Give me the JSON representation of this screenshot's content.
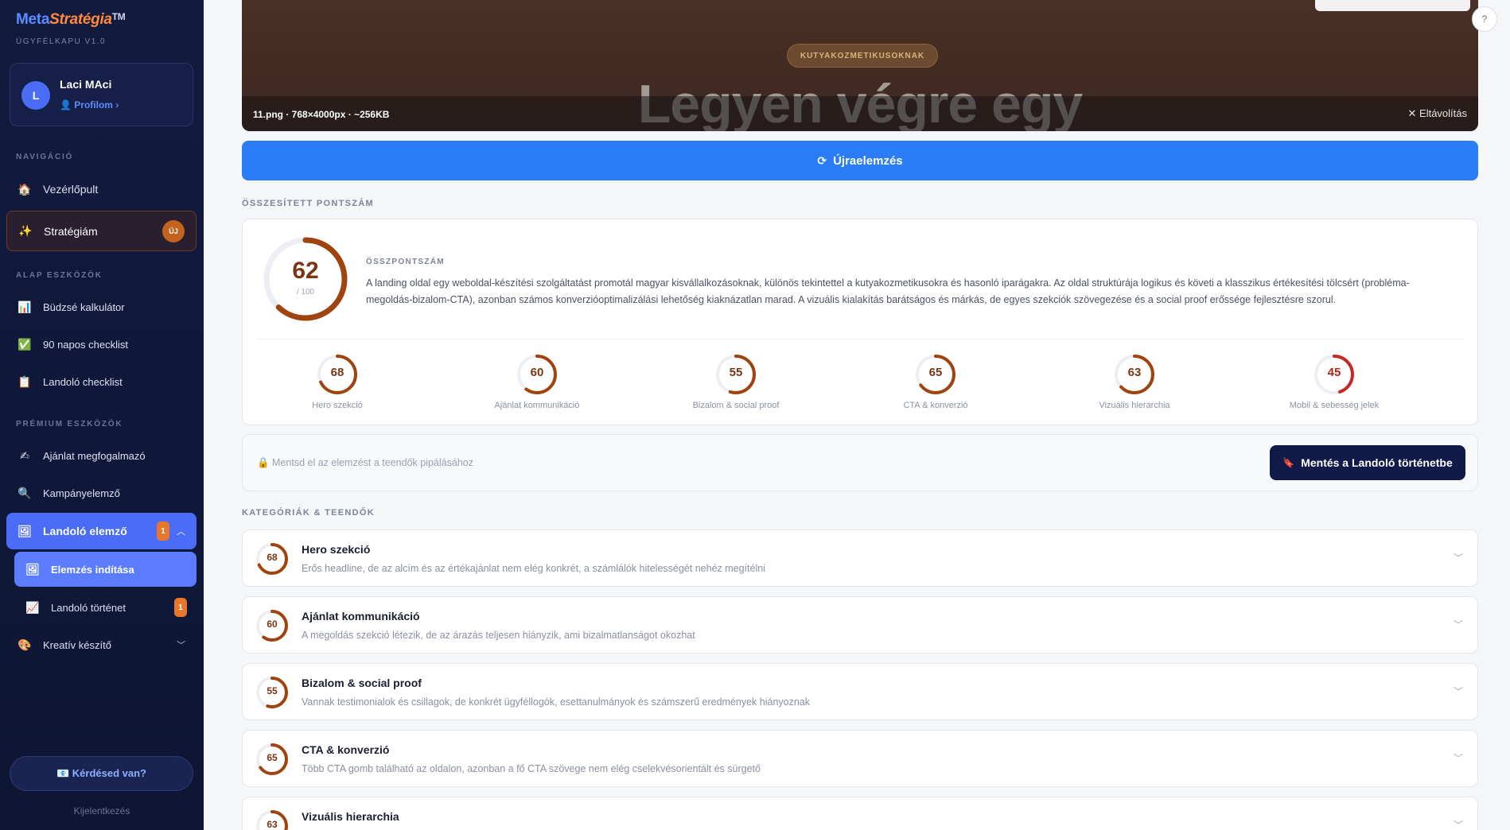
{
  "brand": {
    "part1": "Meta",
    "part2": "Stratégia",
    "tm": "TM",
    "subtitle": "ÜGYFÉLKAPU V1.0"
  },
  "user": {
    "initial": "L",
    "name": "Laci MAci",
    "profile_link": "👤 Profilom ›"
  },
  "sidebar": {
    "nav_label": "NAVIGÁCIÓ",
    "dashboard": {
      "icon": "🏠",
      "label": "Vezérlőpult"
    },
    "strategy": {
      "icon": "✨",
      "label": "Stratégiám",
      "badge": "ÚJ"
    },
    "basic_label": "ALAP ESZKÖZÖK",
    "budget": {
      "icon": "📊",
      "label": "Büdzsé kalkulátor"
    },
    "checklist90": {
      "icon": "✅",
      "label": "90 napos checklist"
    },
    "landing_checklist": {
      "icon": "📋",
      "label": "Landoló checklist"
    },
    "premium_label": "PRÉMIUM ESZKÖZÖK",
    "offer": {
      "icon": "✍",
      "label": "Ajánlat megfogalmazó"
    },
    "campaign": {
      "icon": "🔍",
      "label": "Kampányelemző"
    },
    "landing_analyzer": {
      "icon": "🖼",
      "label": "Landoló elemző",
      "badge": "1"
    },
    "start_analysis": {
      "icon": "🖼",
      "label": "Elemzés indítása"
    },
    "landing_history": {
      "icon": "📈",
      "label": "Landoló történet",
      "badge": "1"
    },
    "creative": {
      "icon": "🎨",
      "label": "Kreatív készítő"
    },
    "help_button": "📧 Kérdésed van?",
    "logout": "Kijelentkezés"
  },
  "preview": {
    "pill_text": "KUTYAKOZMETIKUSOKNAK",
    "headline": "Legyen végre egy",
    "file_info": "11.png · 768×4000px · ~256KB",
    "remove_label": "✕ Eltávolítás",
    "help": "?"
  },
  "reanalyze_label": "Újraelemzés",
  "overall_section_title": "ÖSSZESÍTETT PONTSZÁM",
  "overall": {
    "score": 62,
    "max_label": "/ 100",
    "label": "ÖSSZPONTSZÁM",
    "summary": "A landing oldal egy weboldal-készítési szolgáltatást promotál magyar kisvállalkozásoknak, különös tekintettel a kutyakozmetikusokra és hasonló iparágakra. Az oldal struktúrája logikus és követi a klasszikus értékesítési tölcsért (probléma-megoldás-bizalom-CTA), azonban számos konverzióoptimalizálási lehetőség kiaknázatlan marad. A vizuális kialakítás barátságos és márkás, de egyes szekciók szövegezése és a social proof erőssége fejlesztésre szorul."
  },
  "subscores": [
    {
      "value": 68,
      "label": "Hero szekció",
      "color": "#a0440f"
    },
    {
      "value": 60,
      "label": "Ajánlat kommunikáció",
      "color": "#a0440f"
    },
    {
      "value": 55,
      "label": "Bizalom & social proof",
      "color": "#a0440f"
    },
    {
      "value": 65,
      "label": "CTA & konverzió",
      "color": "#a0440f"
    },
    {
      "value": 63,
      "label": "Vizuális hierarchia",
      "color": "#a0440f"
    },
    {
      "value": 45,
      "label": "Mobil & sebesség jelek",
      "color": "#c62828"
    }
  ],
  "save": {
    "hint": "🔒 Mentsd el az elemzést a teendők pipálásához",
    "button": "Mentés a Landoló történetbe"
  },
  "categories_section_title": "KATEGÓRIÁK & TEENDŐK",
  "categories": [
    {
      "score": 68,
      "title": "Hero szekció",
      "desc": "Erős headline, de az alcím és az értékajánlat nem elég konkrét, a számlálók hitelességét nehéz megítélni"
    },
    {
      "score": 60,
      "title": "Ajánlat kommunikáció",
      "desc": "A megoldás szekció létezik, de az árazás teljesen hiányzik, ami bizalmatlanságot okozhat"
    },
    {
      "score": 55,
      "title": "Bizalom & social proof",
      "desc": "Vannak testimonialok és csillagok, de konkrét ügyféllogók, esettanulmányok és számszerű eredmények hiányoznak"
    },
    {
      "score": 65,
      "title": "CTA & konverzió",
      "desc": "Több CTA gomb található az oldalon, azonban a fő CTA szövege nem elég cselekvésorientált és sürgető"
    },
    {
      "score": 63,
      "title": "Vizuális hierarchia",
      "desc": ""
    }
  ],
  "colors": {
    "accent_blue": "#2a7df6",
    "ring_brown": "#a0440f",
    "ring_red": "#c62828",
    "sidebar_bg": "#121a3e"
  }
}
